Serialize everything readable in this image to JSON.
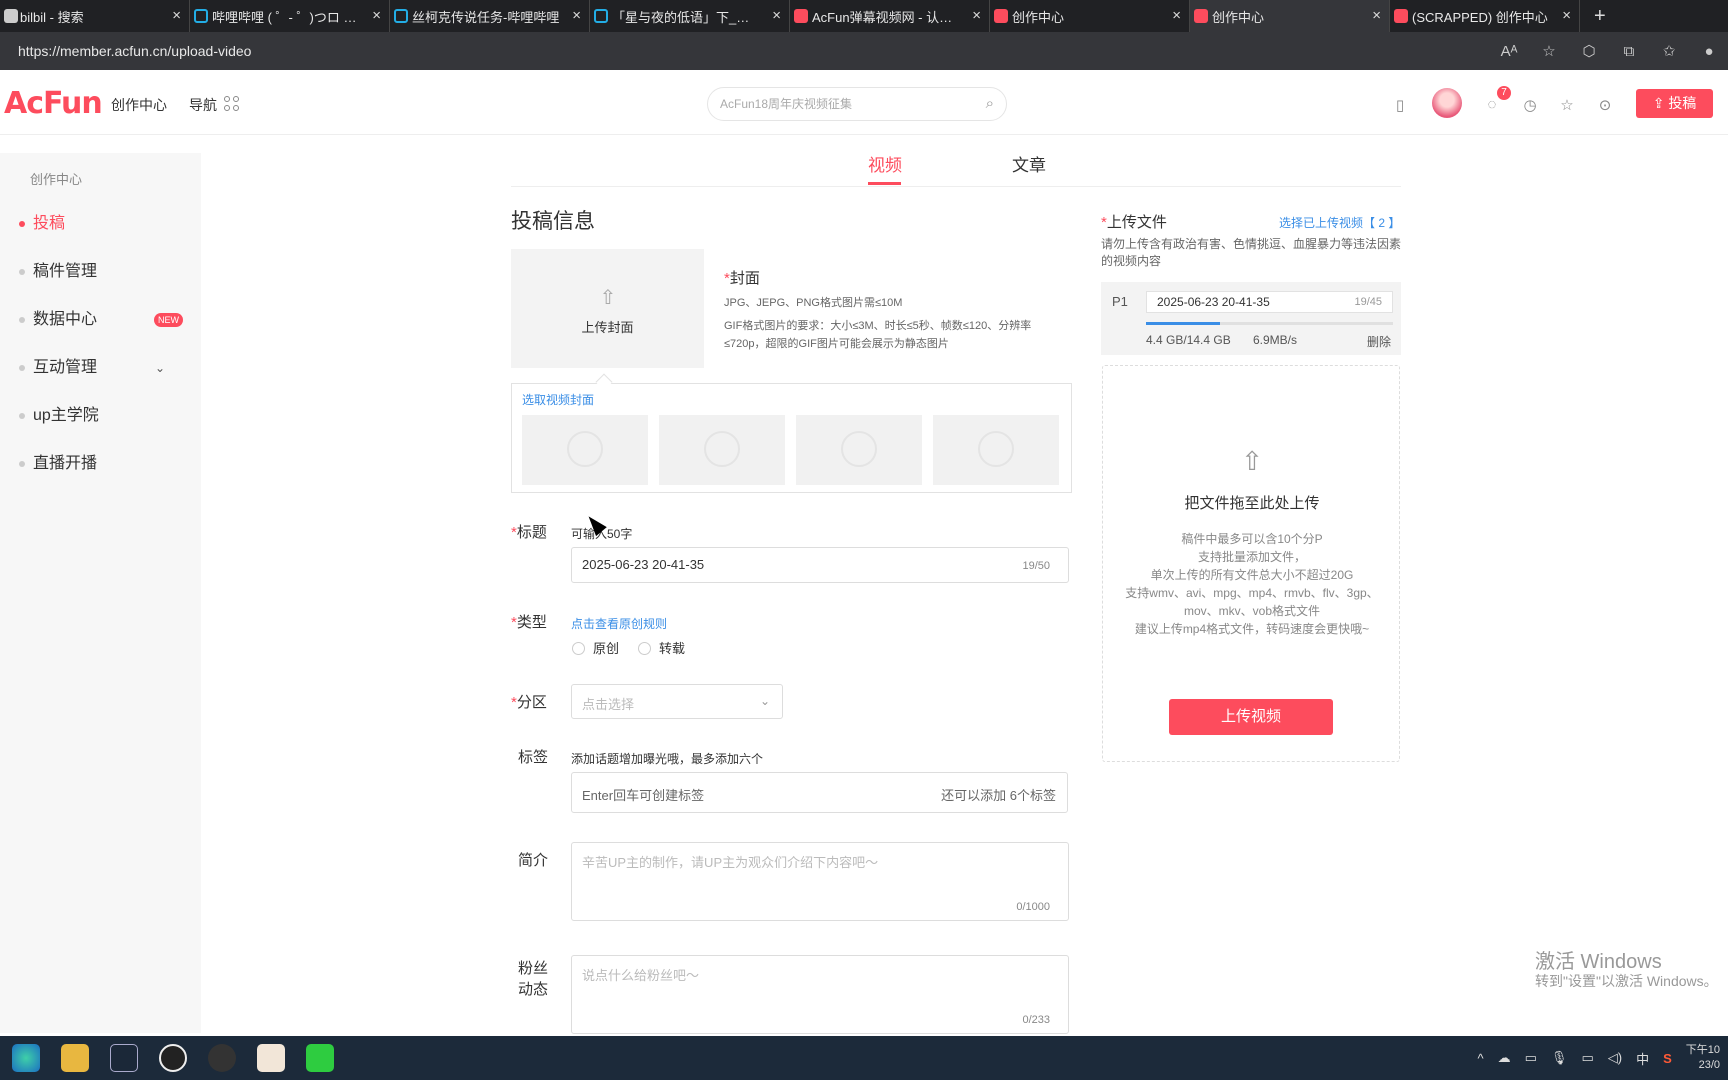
{
  "browser": {
    "tabs": [
      {
        "title": "bilbil - 搜索",
        "icon": "search-favicon"
      },
      {
        "title": "哔哩哔哩 ( ゜- ゜)つロ 干杯",
        "icon": "bilibili-favicon"
      },
      {
        "title": "丝柯克传说任务-哔哩哔哩",
        "icon": "bilibili-favicon"
      },
      {
        "title": "「星与夜的低语」下_哔哩",
        "icon": "bilibili-favicon"
      },
      {
        "title": "AcFun弹幕视频网 - 认真你",
        "icon": "acfun-favicon"
      },
      {
        "title": "创作中心",
        "icon": "acfun-favicon"
      },
      {
        "title": "创作中心",
        "icon": "acfun-favicon"
      },
      {
        "title": "(SCRAPPED) 创作中心",
        "icon": "acfun-favicon"
      }
    ],
    "new_tab": "+",
    "url": "https://member.acfun.cn/upload-video"
  },
  "header": {
    "logo": "AcFun",
    "creator_center": "创作中心",
    "nav": "导航",
    "search_placeholder": "AcFun18周年庆视频征集",
    "message_count": "7",
    "post_button": "投稿"
  },
  "sidebar": {
    "title": "创作中心",
    "items": [
      {
        "label": "投稿",
        "active": true
      },
      {
        "label": "稿件管理"
      },
      {
        "label": "数据中心",
        "badge": "NEW"
      },
      {
        "label": "互动管理",
        "chevron": "chevron-down-icon"
      },
      {
        "label": "up主学院"
      },
      {
        "label": "直播开播"
      }
    ]
  },
  "content_tabs": [
    {
      "label": "视频",
      "active": true
    },
    {
      "label": "文章"
    }
  ],
  "form": {
    "section_title": "投稿信息",
    "cover": {
      "upload_label": "上传封面",
      "label": "封面",
      "hint1": "JPG、JEPG、PNG格式图片需≤10M",
      "hint2": "GIF格式图片的要求：大小≤3M、时长≤5秒、帧数≤120、分辨率≤720p，超限的GIF图片可能会展示为静态图片",
      "pick_link": "选取视频封面"
    },
    "title": {
      "label": "标题",
      "hint": "可输入50字",
      "value": "2025-06-23 20-41-35",
      "count": "19/50"
    },
    "type": {
      "label": "类型",
      "link": "点击查看原创规则",
      "options": [
        "原创",
        "转载"
      ]
    },
    "category": {
      "label": "分区",
      "placeholder": "点击选择"
    },
    "tags": {
      "label": "标签",
      "hint": "添加话题增加曝光哦，最多添加六个",
      "placeholder": "Enter回车可创建标签",
      "remaining": "还可以添加 6个标签"
    },
    "intro": {
      "label": "简介",
      "placeholder": "辛苦UP主的制作，请UP主为观众们介绍下内容吧～",
      "count": "0/1000"
    },
    "fans": {
      "label_line1": "粉丝",
      "label_line2": "动态",
      "placeholder": "说点什么给粉丝吧～",
      "count": "0/233"
    }
  },
  "upload": {
    "label": "上传文件",
    "choose_uploaded": "选择已上传视频【 2 】",
    "warning": "请勿上传含有政治有害、色情挑逗、血腥暴力等违法因素的视频内容",
    "file": {
      "part": "P1",
      "name": "2025-06-23 20-41-35",
      "count": "19/45",
      "progress": 0.3,
      "size": "4.4 GB/14.4 GB",
      "speed": "6.9MB/s",
      "delete": "删除"
    },
    "drop_title": "把文件拖至此处上传",
    "drop_hints": "稿件中最多可以含10个分P\n支持批量添加文件，\n单次上传的所有文件总大小不超过20G\n支持wmv、avi、mpg、mp4、rmvb、flv、3gp、mov、mkv、vob格式文件\n建议上传mp4格式文件，转码速度会更快哦~",
    "button": "上传视频"
  },
  "watermark": {
    "line1": "激活 Windows",
    "line2": "转到\"设置\"以激活 Windows。"
  },
  "taskbar": {
    "ime": "中",
    "time": "下午10",
    "date": "23/0"
  },
  "colors": {
    "accent": "#fd4c5d",
    "link": "#3a8ee6"
  }
}
